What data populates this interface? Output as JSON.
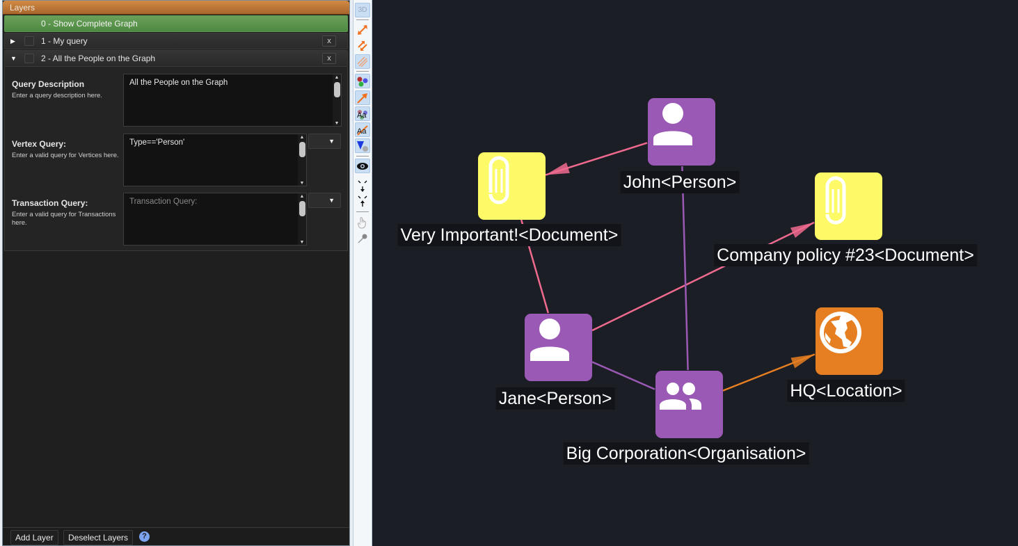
{
  "layers_panel": {
    "title": "Layers",
    "layers": [
      {
        "label": "0  - Show Complete Graph",
        "expanded": null,
        "active": true,
        "removable": false
      },
      {
        "label": "1  - My query",
        "expanded": false,
        "active": false,
        "removable": true
      },
      {
        "label": "2  - All the People on the Graph",
        "expanded": true,
        "active": false,
        "removable": true
      }
    ],
    "remove_label": "x",
    "detail": {
      "query_description": {
        "title": "Query Description",
        "hint": "Enter a query description here.",
        "value": "All the People on the Graph"
      },
      "vertex_query": {
        "title": "Vertex Query:",
        "hint": "Enter a valid query for Vertices here.",
        "value": "Type=='Person'"
      },
      "transaction_query": {
        "title": "Transaction Query:",
        "hint": "Enter a valid query for Transactions here.",
        "value": "",
        "placeholder": "Transaction Query:"
      }
    },
    "footer": {
      "add_layer": "Add Layer",
      "deselect_layers": "Deselect Layers",
      "help_icon": "?"
    }
  },
  "toolbar": {
    "items": [
      {
        "name": "toggle-3d",
        "label": "3D",
        "active": true
      },
      {
        "name": "show-links",
        "icon": "double-arrow-icon",
        "active": false
      },
      {
        "name": "show-edges",
        "icon": "split-arrows-icon",
        "active": false
      },
      {
        "name": "show-transactions",
        "icon": "multi-arrows-icon",
        "active": true
      },
      {
        "name": "node-colors",
        "icon": "color-dots-icon",
        "active": true
      },
      {
        "name": "connection-arrows",
        "icon": "arrow-icon",
        "active": true
      },
      {
        "name": "node-labels",
        "icon": "node-labels-icon",
        "label": "Aa",
        "active": true
      },
      {
        "name": "connection-labels",
        "icon": "connection-labels-icon",
        "label": "Aa",
        "active": true
      },
      {
        "name": "blazes",
        "icon": "blaze-icon",
        "active": true
      },
      {
        "name": "visibility",
        "icon": "eye-icon",
        "active": true
      },
      {
        "name": "expand-collapse",
        "icon": "expand-collapse-icon",
        "active": false
      },
      {
        "name": "select-mode",
        "icon": "hand-icon",
        "active": false
      },
      {
        "name": "add-mode",
        "icon": "pin-icon",
        "active": false
      }
    ]
  },
  "graph": {
    "colors": {
      "background": "#1c1e26",
      "person": "#9b59b6",
      "document": "#fdfa68",
      "location": "#e67e22",
      "organisation": "#9b59b6",
      "link_pink": "#f06a8f",
      "link_purple": "#9b59b6",
      "link_orange": "#e67e22"
    },
    "nodes": [
      {
        "id": "john",
        "label": "John<Person>",
        "type": "person",
        "icon": "person-icon"
      },
      {
        "id": "very-important",
        "label": "Very Important!<Document>",
        "type": "document",
        "icon": "paperclip-icon"
      },
      {
        "id": "company-policy",
        "label": "Company policy #23<Document>",
        "type": "document",
        "icon": "paperclip-icon"
      },
      {
        "id": "jane",
        "label": "Jane<Person>",
        "type": "person",
        "icon": "person-icon"
      },
      {
        "id": "big-corp",
        "label": "Big Corporation<Organisation>",
        "type": "organisation",
        "icon": "group-icon"
      },
      {
        "id": "hq",
        "label": "HQ<Location>",
        "type": "location",
        "icon": "globe-icon"
      }
    ],
    "edges": [
      {
        "from": "john",
        "to": "very-important",
        "color": "link_pink",
        "directed": true
      },
      {
        "from": "jane",
        "to": "very-important",
        "color": "link_pink",
        "directed": true
      },
      {
        "from": "jane",
        "to": "company-policy",
        "color": "link_pink",
        "directed": true
      },
      {
        "from": "john",
        "to": "big-corp",
        "color": "link_purple",
        "directed": false
      },
      {
        "from": "jane",
        "to": "big-corp",
        "color": "link_purple",
        "directed": false
      },
      {
        "from": "big-corp",
        "to": "hq",
        "color": "link_orange",
        "directed": true
      }
    ]
  }
}
